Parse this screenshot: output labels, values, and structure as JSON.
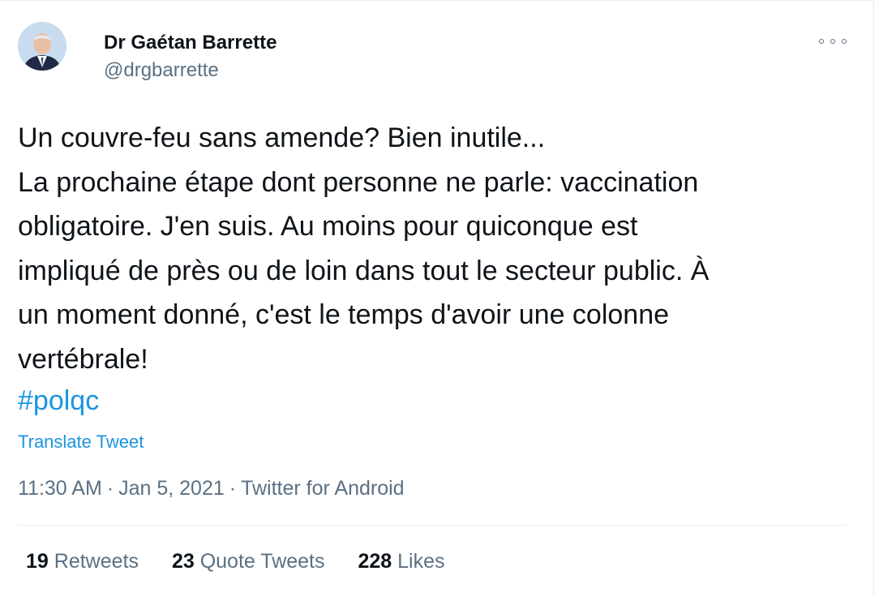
{
  "author": {
    "name": "Dr Gaétan Barrette",
    "handle": "@drgbarrette"
  },
  "tweet": {
    "lines": [
      "Un couvre-feu sans amende? Bien inutile...",
      "La prochaine étape dont personne ne parle: vaccination",
      "obligatoire. J'en suis. Au moins pour quiconque est",
      "impliqué de près ou de loin dans tout le secteur public. À",
      "un moment donné, c'est le temps d'avoir une colonne",
      "vertébrale!"
    ],
    "hashtag": "#polqc",
    "translate_label": "Translate Tweet"
  },
  "meta": {
    "time": "11:30 AM",
    "separator": "·",
    "date": "Jan 5, 2021",
    "source": "Twitter for Android"
  },
  "stats": {
    "retweets": {
      "count": "19",
      "label": "Retweets"
    },
    "quote_tweets": {
      "count": "23",
      "label": "Quote Tweets"
    },
    "likes": {
      "count": "228",
      "label": "Likes"
    }
  },
  "icons": {
    "more": "more-horizontal-icon"
  },
  "colors": {
    "link": "#1b95e0",
    "secondary_text": "#5b7083",
    "primary_text": "#0f1419",
    "divider": "#e6ecf0"
  }
}
